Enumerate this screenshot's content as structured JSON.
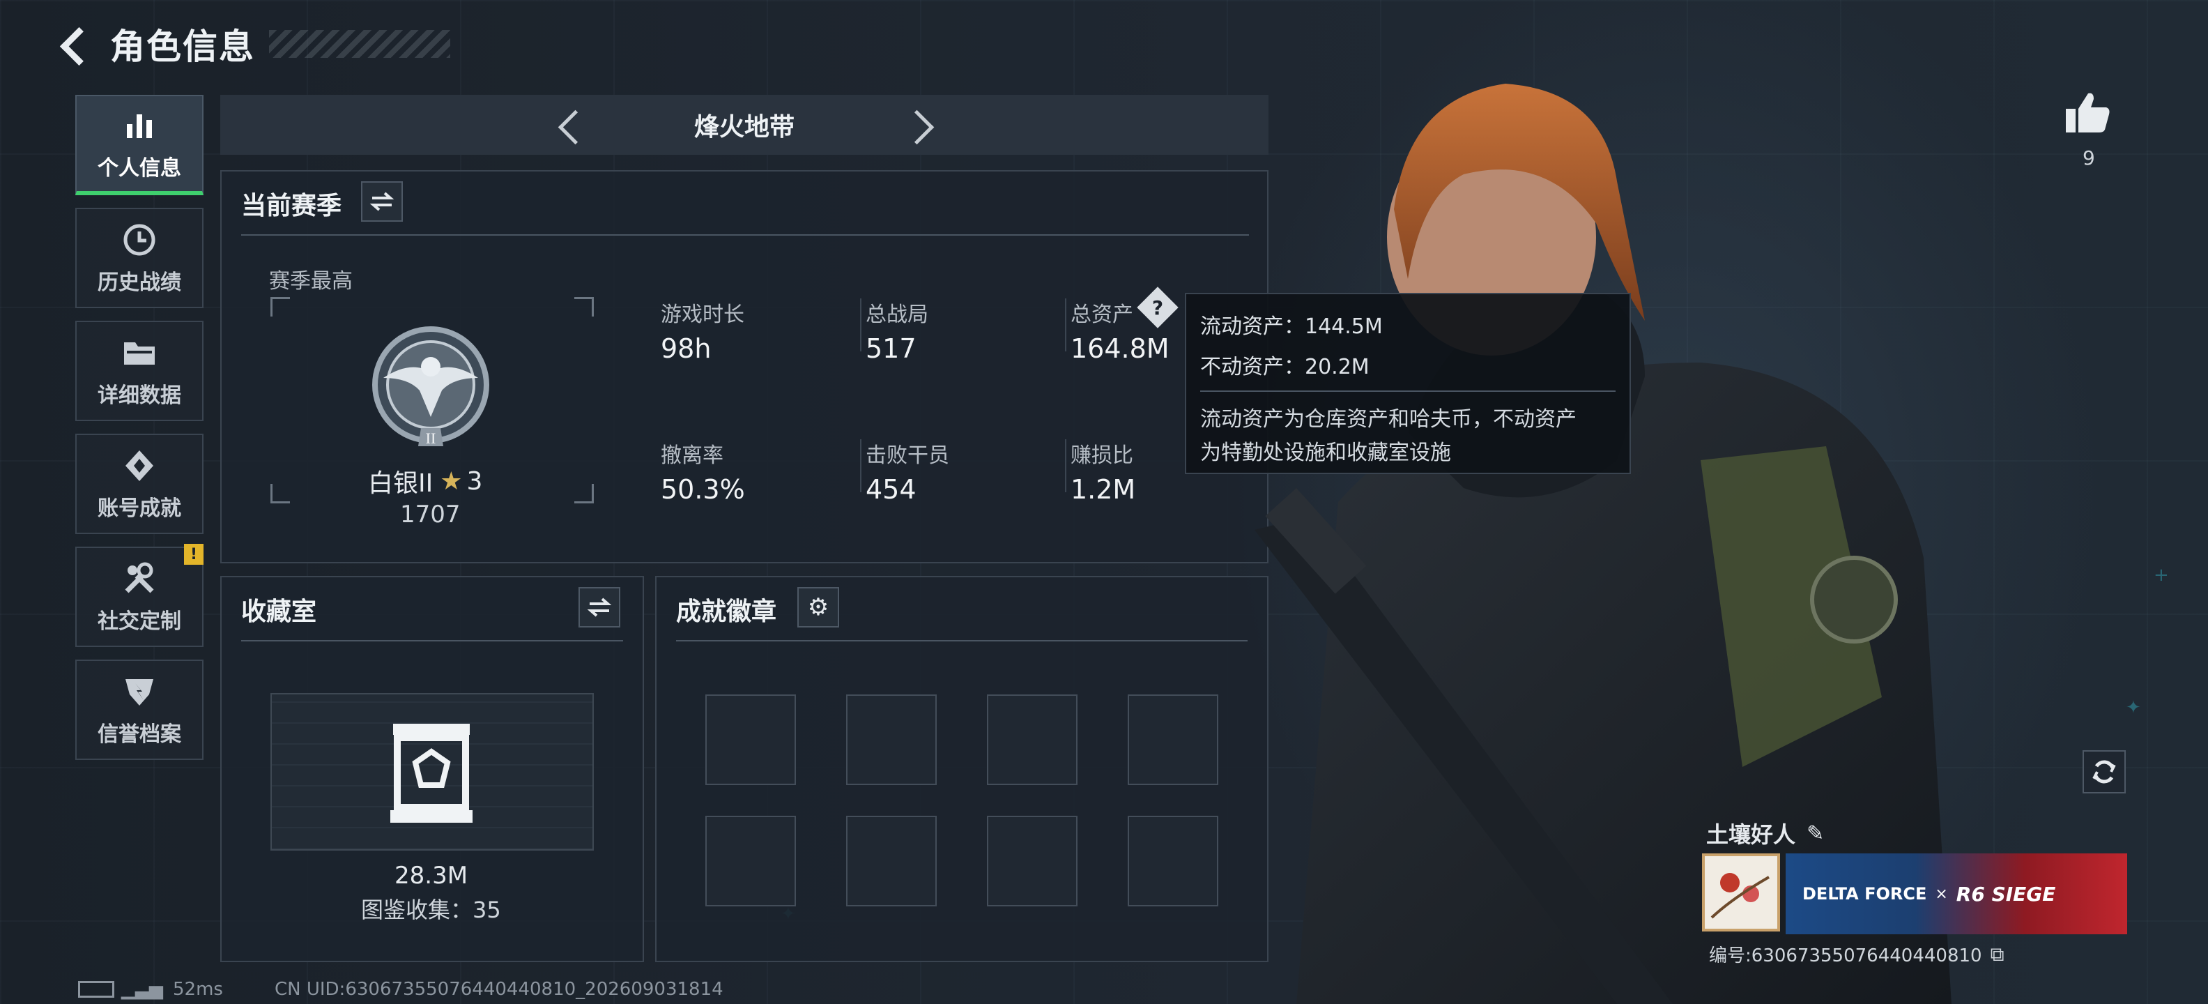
{
  "header": {
    "title": "角色信息"
  },
  "sidebar": {
    "items": [
      {
        "label": "个人信息",
        "icon": "bar-chart-icon",
        "active": true
      },
      {
        "label": "历史战绩",
        "icon": "clock-icon"
      },
      {
        "label": "详细数据",
        "icon": "folder-icon"
      },
      {
        "label": "账号成就",
        "icon": "achievement-icon"
      },
      {
        "label": "社交定制",
        "icon": "tools-icon",
        "alert": "!"
      },
      {
        "label": "信誉档案",
        "icon": "credit-shield-icon"
      }
    ]
  },
  "mode": {
    "title": "烽火地带"
  },
  "season": {
    "title": "当前赛季",
    "best_label": "赛季最高",
    "rank_name": "白银II",
    "rank_stars": "3",
    "rank_points": "1707",
    "stats": [
      {
        "label": "游戏时长",
        "value": "98h"
      },
      {
        "label": "总战局",
        "value": "517"
      },
      {
        "label": "总资产",
        "value": "164.8M"
      },
      {
        "label": "撤离率",
        "value": "50.3%"
      },
      {
        "label": "击败干员",
        "value": "454"
      },
      {
        "label": "赚损比",
        "value": "1.2M"
      }
    ]
  },
  "tooltip": {
    "liquid": "流动资产：144.5M",
    "fixed": "不动资产：20.2M",
    "desc_line1": "流动资产为仓库资产和哈夫币，不动资产",
    "desc_line2": "为特勤处设施和收藏室设施"
  },
  "collection": {
    "title": "收藏室",
    "value": "28.3M",
    "gallery": "图鉴收集：35"
  },
  "badges": {
    "title": "成就徽章"
  },
  "likes": {
    "count": "9"
  },
  "player": {
    "name": "土壤好人",
    "id_text": "编号:630673550764404408​10",
    "banner_brand1": "DELTA FORCE",
    "banner_x": "×",
    "banner_brand2": "R6 SIEGE"
  },
  "status": {
    "ping": "52ms",
    "uid": "CN UID:630673550764404408​10_202609031814"
  },
  "colors": {
    "accent_green": "#3fd06e",
    "alert_yellow": "#e3b52a",
    "banner_red": "#c0262e"
  }
}
